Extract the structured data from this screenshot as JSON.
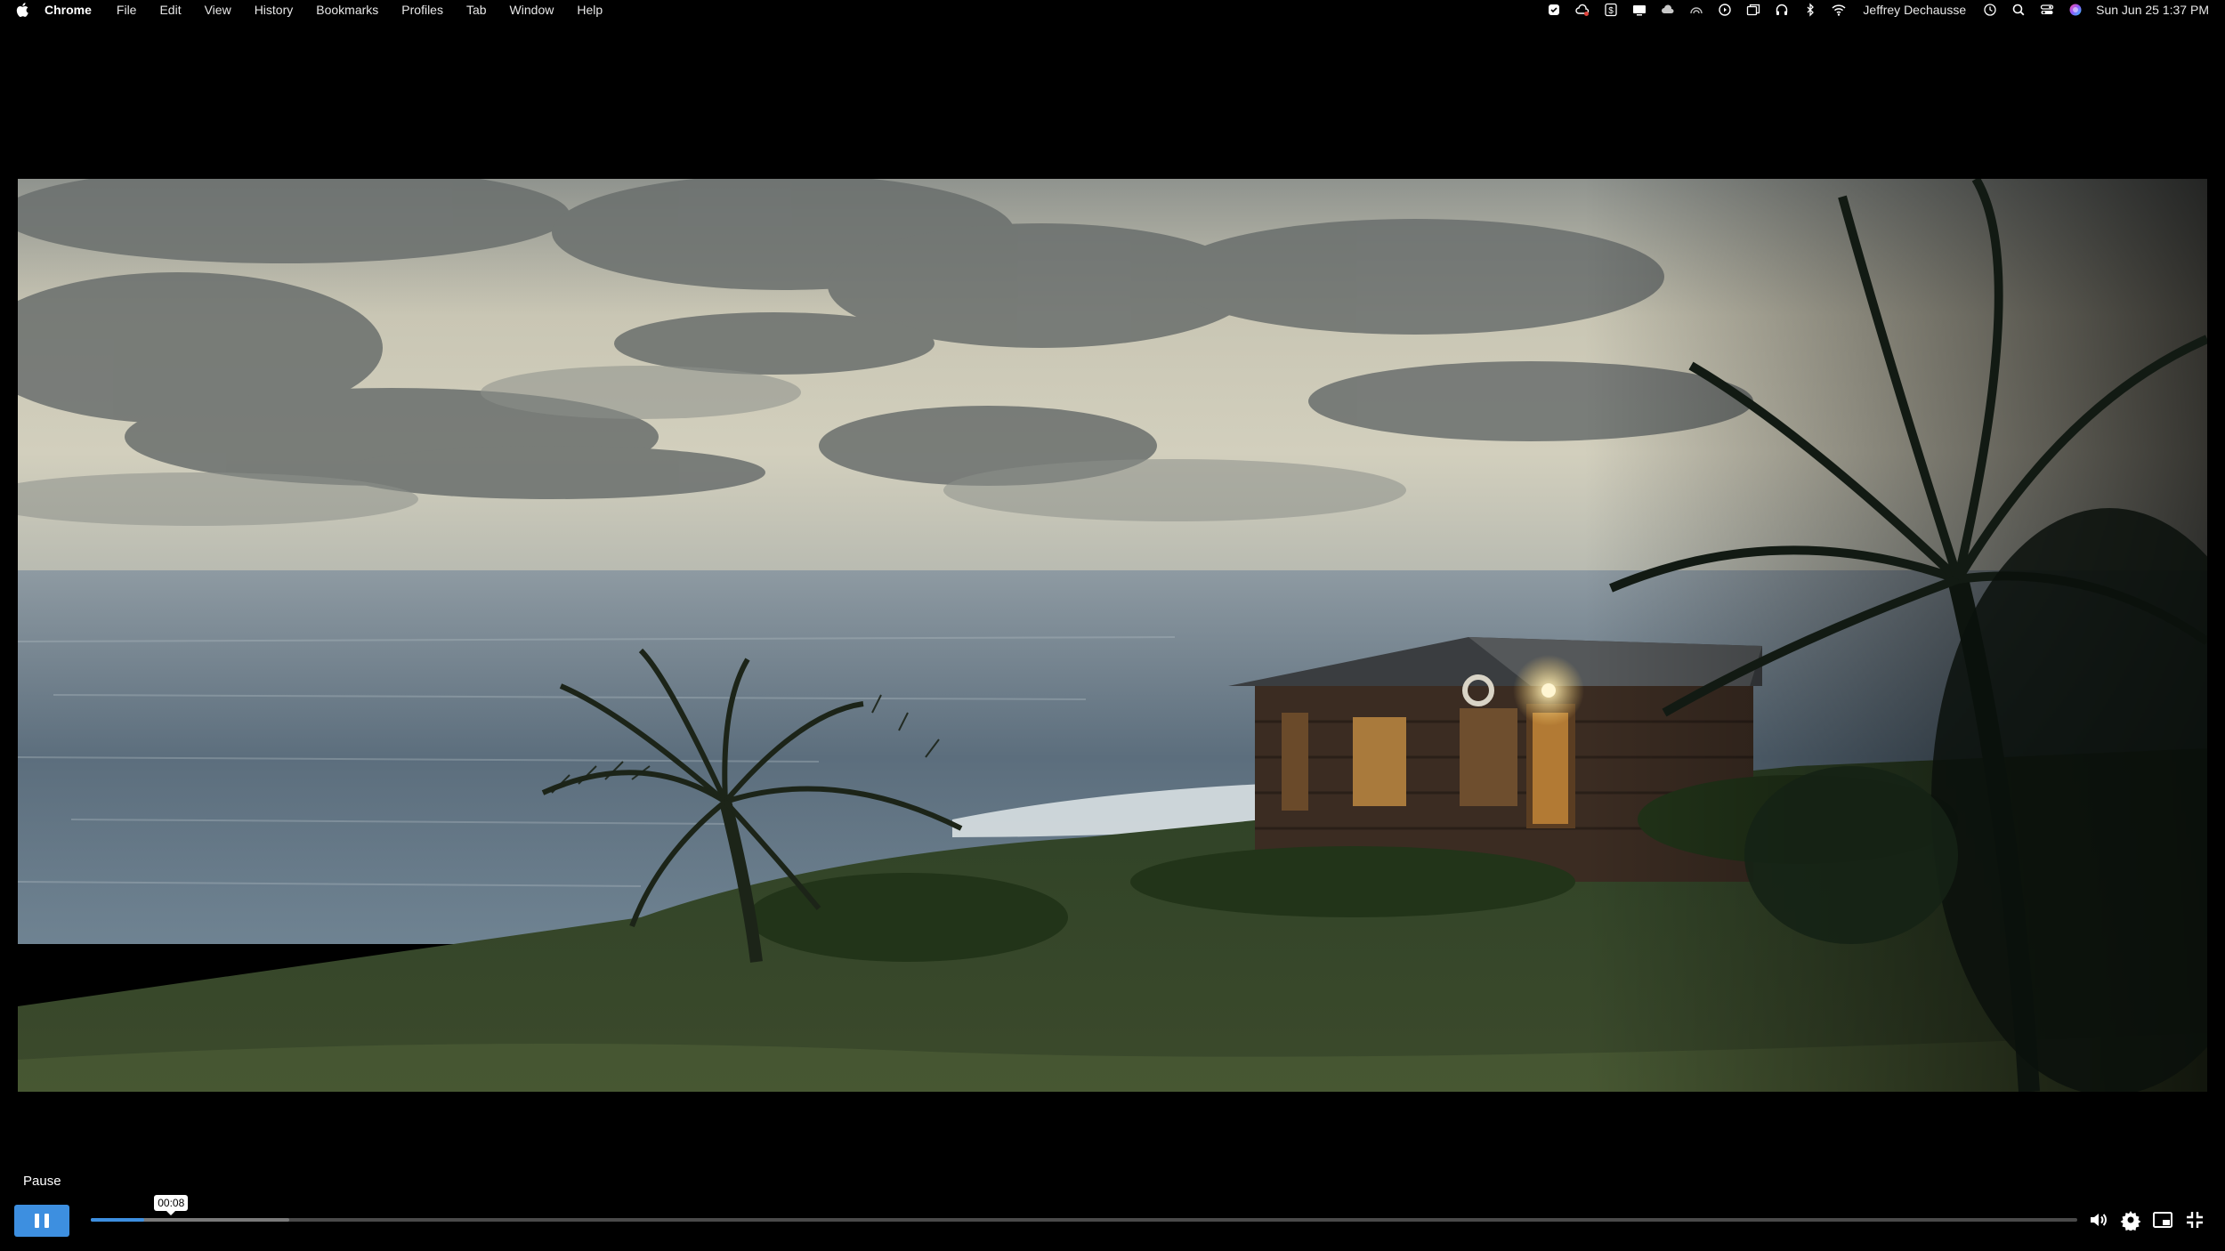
{
  "menubar": {
    "apple_icon": "apple-logo-icon",
    "app_name": "Chrome",
    "menus": [
      "File",
      "Edit",
      "View",
      "History",
      "Bookmarks",
      "Profiles",
      "Tab",
      "Window",
      "Help"
    ],
    "status_icons": [
      "checkbox-icon",
      "creative-cloud-icon",
      "dollar-app-icon",
      "display-icon",
      "cloud-icon",
      "airdrop-icon",
      "play-circle-icon",
      "copy-windows-icon",
      "headphones-icon",
      "bluetooth-icon",
      "wifi-icon"
    ],
    "user_name": "Jeffrey Dechausse",
    "trailing_icons": [
      "time-machine-icon",
      "search-icon",
      "control-center-icon",
      "siri-icon"
    ],
    "clock": "Sun Jun 25  1:37 PM"
  },
  "player": {
    "tooltip_label": "Pause",
    "current_time": "00:08",
    "progress": 0.027,
    "buffered": 0.1,
    "controls": [
      "volume-icon",
      "settings-gear-icon",
      "picture-in-picture-icon",
      "exit-fullscreen-icon"
    ],
    "accent_color": "#3d8fe0"
  },
  "video": {
    "scene": "coastal-hut-at-dusk"
  }
}
